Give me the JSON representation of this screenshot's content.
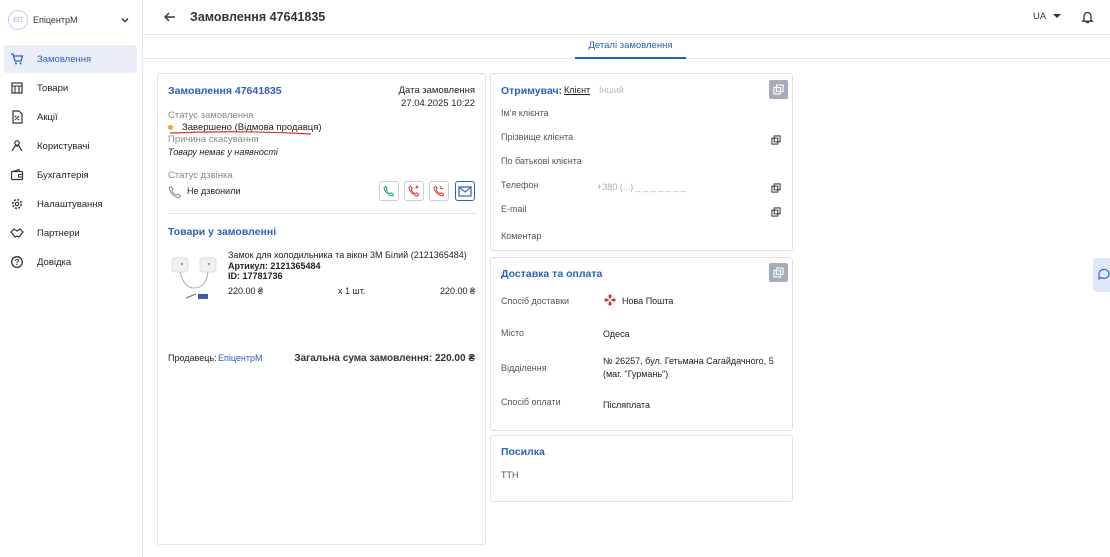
{
  "sidebar": {
    "org_initials": "ЕП",
    "org_name": "ЕпіцентрМ",
    "items": [
      {
        "label": "Замовлення",
        "icon": "cart-icon",
        "active": true
      },
      {
        "label": "Товари",
        "icon": "store-icon"
      },
      {
        "label": "Акції",
        "icon": "discount-icon"
      },
      {
        "label": "Користувачі",
        "icon": "users-icon"
      },
      {
        "label": "Бухгалтерія",
        "icon": "wallet-icon"
      },
      {
        "label": "Налаштування",
        "icon": "gear-icon"
      },
      {
        "label": "Партнери",
        "icon": "handshake-icon"
      },
      {
        "label": "Довідка",
        "icon": "help-icon"
      }
    ]
  },
  "header": {
    "title": "Замовлення 47641835",
    "lang": "UA"
  },
  "tabs": {
    "details": "Деталі замовлення"
  },
  "order": {
    "title": "Замовлення 47641835",
    "date_label": "Дата замовлення",
    "date_value": "27.04.2025 10:22",
    "status_label": "Статус замовлення",
    "status_value": "Завершено (Відмова продавця)",
    "cancel_reason_label": "Причина скасування",
    "cancel_reason_value": "Товару немає у наявності",
    "call_status_label": "Статус дзвінка",
    "call_status_value": "Не дзвонили",
    "colors": {
      "status_dot": "#f5a623",
      "underline": "#d9302c",
      "call_green": "#22a66b",
      "call_red": "#d9302c",
      "email_blue": "#2d5fb7"
    }
  },
  "products": {
    "title": "Товари у замовленні",
    "item": {
      "name": "Замок для холодильника та вікон 3M Білий (2121365484)",
      "article": "Артикул: 2121365484",
      "id": "ID: 17781736",
      "price": "220.00 ₴",
      "qty": "x 1 шт.",
      "total": "220.00 ₴"
    },
    "seller_label": "Продавець:",
    "seller_value": "ЕпіцентрМ",
    "sum_label": "Загальна сума замовлення: 220.00 ₴"
  },
  "recipient": {
    "title": "Отримувач:",
    "tab_client": "Клієнт",
    "tab_other": "Інший",
    "first_name": "Ім'я клієнта",
    "last_name": "Прізвище клієнта",
    "middle_name": "По батькові клієнта",
    "phone_label": "Телефон",
    "phone_value": "+380 (...) _ _ _ _ _ _ _",
    "email_label": "E-mail",
    "comment_label": "Коментар"
  },
  "delivery": {
    "title": "Доставка та оплата",
    "method_label": "Спосіб доставки",
    "method_value": "Нова Пошта",
    "city_label": "Місто",
    "city_value": "Одеса",
    "branch_label": "Відділення",
    "branch_line1": "№ 26257, бул. Гетьмана Сагайдачного, 5",
    "branch_line2": "(маг. \"Гурмань\")",
    "payment_label": "Спосіб оплати",
    "payment_value": "Післяплата",
    "np_color": "#d9302c"
  },
  "parcel": {
    "title": "Посилка",
    "ttn_label": "ТТН"
  }
}
